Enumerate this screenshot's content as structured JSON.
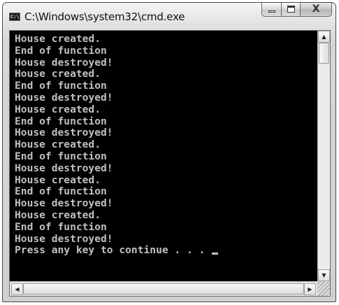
{
  "window": {
    "title": "C:\\Windows\\system32\\cmd.exe",
    "icon": "cmd-console-icon",
    "icon_text": "C:\\."
  },
  "caption_buttons": {
    "minimize_icon": "minimize-icon",
    "maximize_icon": "maximize-icon",
    "close_icon": "close-icon",
    "close_glyph": "X"
  },
  "console": {
    "background": "#000000",
    "foreground": "#c0c0c0",
    "lines": [
      "House created.",
      "End of function",
      "House destroyed!",
      "House created.",
      "End of function",
      "House destroyed!",
      "House created.",
      "End of function",
      "House destroyed!",
      "House created.",
      "End of function",
      "House destroyed!",
      "House created.",
      "End of function",
      "House destroyed!",
      "House created.",
      "End of function",
      "House destroyed!",
      "Press any key to continue . . . "
    ]
  },
  "scrollbars": {
    "up_arrow": "▲",
    "down_arrow": "▼",
    "left_arrow": "◀",
    "right_arrow": "▶"
  }
}
